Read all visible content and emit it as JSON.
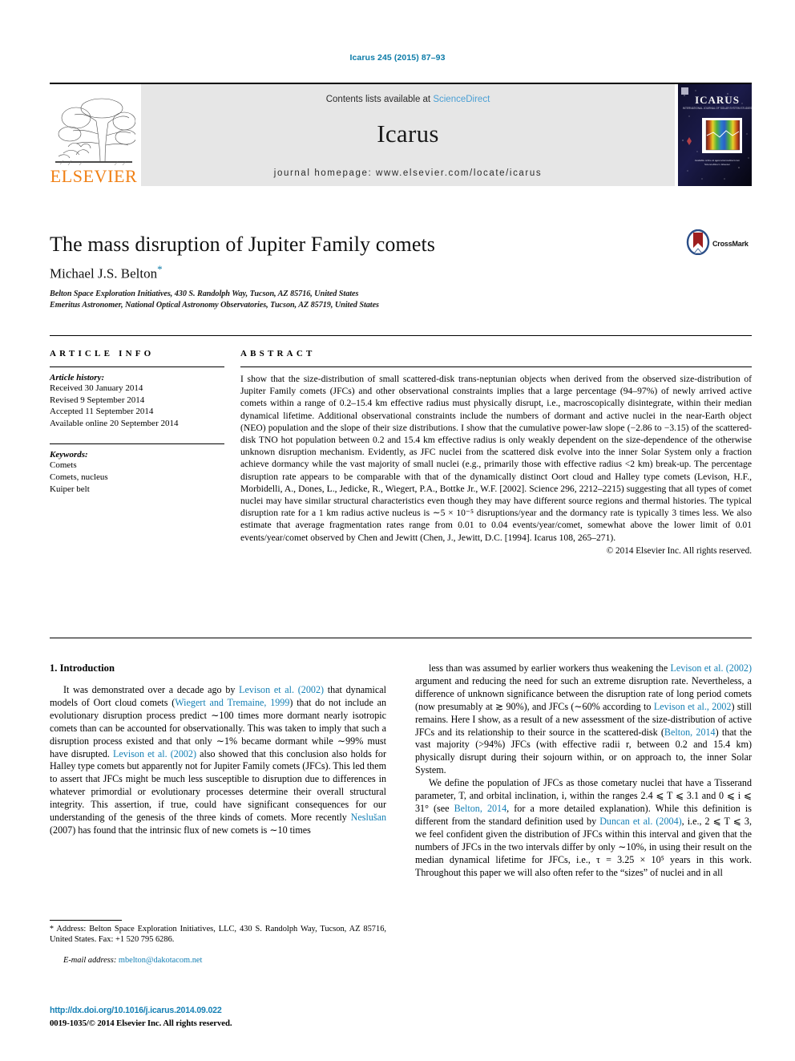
{
  "running_head": "Icarus 245 (2015) 87–93",
  "masthead": {
    "publisher_name": "ELSEVIER",
    "publisher_logo_icon": "elsevier-tree-icon",
    "contents_prefix": "Contents lists available at ",
    "contents_link": "ScienceDirect",
    "journal_name": "Icarus",
    "homepage_line": "journal homepage: www.elsevier.com/locate/icarus",
    "cover_title": "ICARUS",
    "cover_subtitle": "International Journal of Solar System Studies",
    "cover_caption": "Available online at www.sciencedirect.com",
    "colors": {
      "elsevier_orange": "#f07f13",
      "band_gray": "#e6e6e6",
      "link_blue": "#4a9fd4",
      "running_head_blue": "#0b7ba8"
    }
  },
  "crossmark": {
    "label": "CrossMark",
    "icon": "crossmark-icon"
  },
  "article": {
    "title": "The mass disruption of Jupiter Family comets",
    "author": "Michael J.S. Belton",
    "corresponding_marker": "*",
    "affiliations": [
      "Belton Space Exploration Initiatives, 430 S. Randolph Way, Tucson, AZ 85716, United States",
      "Emeritus Astronomer, National Optical Astronomy Observatories, Tucson, AZ 85719, United States"
    ]
  },
  "article_info": {
    "heading": "ARTICLE INFO",
    "history_label": "Article history:",
    "history": [
      "Received 30 January 2014",
      "Revised 9 September 2014",
      "Accepted 11 September 2014",
      "Available online 20 September 2014"
    ],
    "keywords_label": "Keywords:",
    "keywords": [
      "Comets",
      "Comets, nucleus",
      "Kuiper belt"
    ]
  },
  "abstract": {
    "heading": "ABSTRACT",
    "text": "I show that the size-distribution of small scattered-disk trans-neptunian objects when derived from the observed size-distribution of Jupiter Family comets (JFCs) and other observational constraints implies that a large percentage (94–97%) of newly arrived active comets within a range of 0.2–15.4 km effective radius must physically disrupt, i.e., macroscopically disintegrate, within their median dynamical lifetime. Additional observational constraints include the numbers of dormant and active nuclei in the near-Earth object (NEO) population and the slope of their size distributions. I show that the cumulative power-law slope (−2.86 to −3.15) of the scattered-disk TNO hot population between 0.2 and 15.4 km effective radius is only weakly dependent on the size-dependence of the otherwise unknown disruption mechanism. Evidently, as JFC nuclei from the scattered disk evolve into the inner Solar System only a fraction achieve dormancy while the vast majority of small nuclei (e.g., primarily those with effective radius <2 km) break-up. The percentage disruption rate appears to be comparable with that of the dynamically distinct Oort cloud and Halley type comets (Levison, H.F., Morbidelli, A., Dones, L., Jedicke, R., Wiegert, P.A., Bottke Jr., W.F. [2002]. Science 296, 2212–2215) suggesting that all types of comet nuclei may have similar structural characteristics even though they may have different source regions and thermal histories. The typical disruption rate for a 1 km radius active nucleus is ∼5 × 10⁻⁵ disruptions/year and the dormancy rate is typically 3 times less. We also estimate that average fragmentation rates range from 0.01 to 0.04 events/year/comet, somewhat above the lower limit of 0.01 events/year/comet observed by Chen and Jewitt (Chen, J., Jewitt, D.C. [1994]. Icarus 108, 265–271).",
    "copyright": "© 2014 Elsevier Inc. All rights reserved."
  },
  "body": {
    "section_heading": "1. Introduction",
    "left_paragraph_1": "It was demonstrated over a decade ago by Levison et al. (2002) that dynamical models of Oort cloud comets (Wiegert and Tremaine, 1999) that do not include an evolutionary disruption process predict ∼100 times more dormant nearly isotropic comets than can be accounted for observationally. This was taken to imply that such a disruption process existed and that only ∼1% became dormant while ∼99% must have disrupted. Levison et al. (2002) also showed that this conclusion also holds for Halley type comets but apparently not for Jupiter Family comets (JFCs). This led them to assert that JFCs might be much less susceptible to disruption due to differences in whatever primordial or evolutionary processes determine their overall structural integrity. This assertion, if true, could have significant consequences for our understanding of the genesis of the three kinds of comets. More recently Neslušan (2007) has found that the intrinsic flux of new comets is ∼10 times",
    "right_paragraph_1": "less than was assumed by earlier workers thus weakening the Levison et al. (2002) argument and reducing the need for such an extreme disruption rate. Nevertheless, a difference of unknown significance between the disruption rate of long period comets (now presumably at ≳ 90%), and JFCs (∼60% according to Levison et al., 2002) still remains. Here I show, as a result of a new assessment of the size-distribution of active JFCs and its relationship to their source in the scattered-disk (Belton, 2014) that the vast majority (>94%) JFCs (with effective radii r, between 0.2 and 15.4 km) physically disrupt during their sojourn within, or on approach to, the inner Solar System.",
    "right_paragraph_2": "We define the population of JFCs as those cometary nuclei that have a Tisserand parameter, T, and orbital inclination, i, within the ranges 2.4 ⩽ T ⩽ 3.1 and 0 ⩽ i ⩽ 31° (see Belton, 2014, for a more detailed explanation). While this definition is different from the standard definition used by Duncan et al. (2004), i.e., 2 ⩽ T ⩽ 3, we feel confident given the distribution of JFCs within this interval and given that the numbers of JFCs in the two intervals differ by only ∼10%, in using their result on the median dynamical lifetime for JFCs, i.e., τ = 3.25 × 10⁵ years in this work. Throughout this paper we will also often refer to the “sizes” of nuclei and in all"
  },
  "footnote": {
    "marker": "*",
    "address": " Address: Belton Space Exploration Initiatives, LLC, 430 S. Randolph Way, Tucson, AZ 85716, United States. Fax: +1 520 795 6286.",
    "email_label": "E-mail address:",
    "email": "mbelton@dakotacom.net"
  },
  "footer": {
    "doi": "http://dx.doi.org/10.1016/j.icarus.2014.09.022",
    "issn_copyright": "0019-1035/© 2014 Elsevier Inc. All rights reserved."
  }
}
